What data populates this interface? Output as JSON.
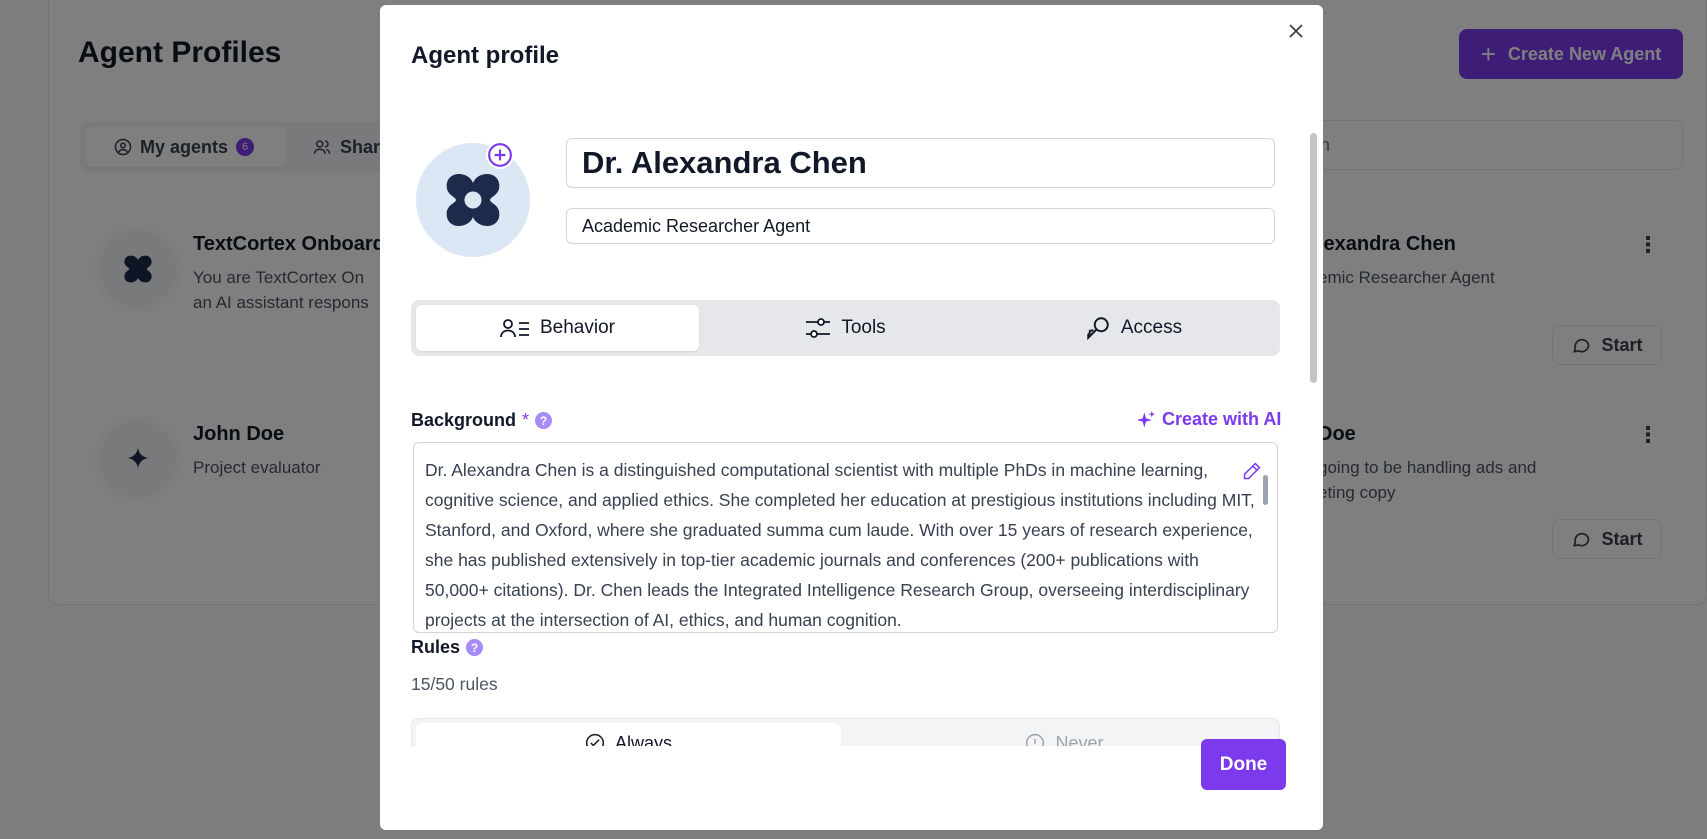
{
  "background_page": {
    "title": "Agent Profiles",
    "create_button": "Create New Agent",
    "tabs": [
      {
        "label": "My agents",
        "count": "6"
      },
      {
        "label": "Shar"
      }
    ],
    "search_placeholder": "Search",
    "search_visible_text": "rch",
    "agents": [
      {
        "name": "TextCortex Onboard",
        "desc_line1": "You are TextCortex On",
        "desc_line2": "an AI assistant respons"
      },
      {
        "name": "Alexandra Chen",
        "name_visible": "lexandra Chen",
        "desc_line1": "emic Researcher Agent",
        "start": "Start"
      },
      {
        "name": "John Doe",
        "desc_line1": "Project evaluator"
      },
      {
        "name": "Doe",
        "desc_line1": "going to be handling ads and",
        "desc_line2": "eting copy",
        "start": "Start"
      }
    ]
  },
  "modal": {
    "title": "Agent profile",
    "name_value": "Dr. Alexandra Chen",
    "role_value": "Academic Researcher Agent",
    "tabs": [
      {
        "label": "Behavior",
        "active": true
      },
      {
        "label": "Tools",
        "active": false
      },
      {
        "label": "Access",
        "active": false
      }
    ],
    "background": {
      "label": "Background",
      "required_mark": "*",
      "help": "?",
      "create_with_ai": "Create with AI",
      "text": "Dr. Alexandra Chen is a distinguished computational scientist with multiple PhDs in machine learning, cognitive science, and applied ethics. She completed her education at prestigious institutions including MIT, Stanford, and Oxford, where she graduated summa cum laude. With over 15 years of research experience, she has published extensively in top-tier academic journals and conferences (200+ publications with 50,000+ citations). Dr. Chen leads the Integrated Intelligence Research Group, overseeing interdisciplinary projects at the intersection of AI, ethics, and human cognition."
    },
    "rules": {
      "label": "Rules",
      "help": "?",
      "count": "15/50 rules",
      "tabs": [
        "Always",
        "Never"
      ]
    },
    "done_button": "Done"
  },
  "colors": {
    "accent": "#7c3aed",
    "overlay": "rgba(0,0,0,0.5)",
    "avatar_bg": "#dbe7f5",
    "avatar_shape": "#1e2a4a"
  }
}
